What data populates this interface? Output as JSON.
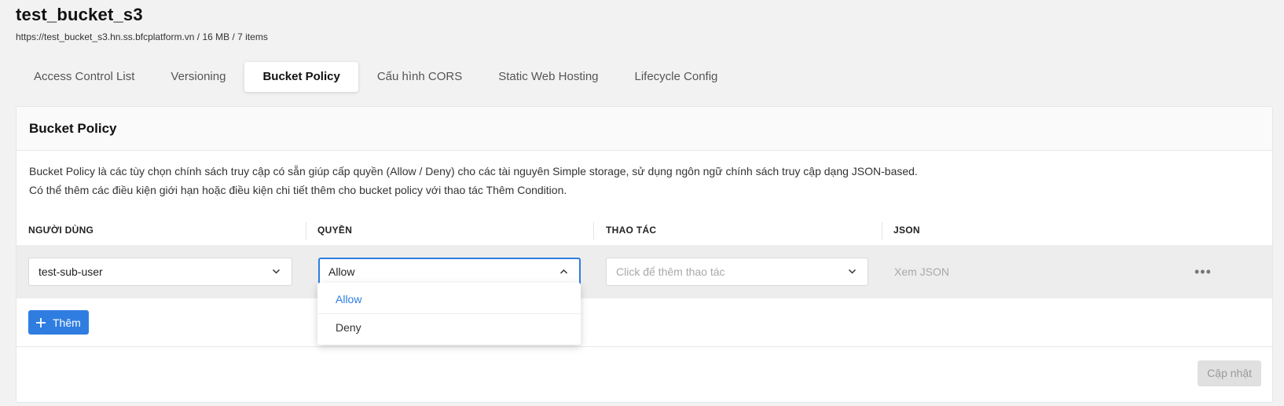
{
  "header": {
    "title": "test_bucket_s3",
    "subtitle": "https://test_bucket_s3.hn.ss.bfcplatform.vn / 16 MB / 7 items"
  },
  "tabs": [
    {
      "label": "Access Control List"
    },
    {
      "label": "Versioning"
    },
    {
      "label": "Bucket Policy",
      "active": true
    },
    {
      "label": "Cấu hình CORS"
    },
    {
      "label": "Static Web Hosting"
    },
    {
      "label": "Lifecycle Config"
    }
  ],
  "panel": {
    "title": "Bucket Policy",
    "description_line1": "Bucket Policy là các tùy chọn chính sách truy cập có sẵn giúp cấp quyền (Allow / Deny) cho các tài nguyên Simple storage, sử dụng ngôn ngữ chính sách truy cập dạng JSON-based.",
    "description_line2": "Có thể thêm các điều kiện giới hạn hoặc điều kiện chi tiết thêm cho bucket policy với thao tác Thêm Condition."
  },
  "columns": {
    "user": "NGƯỜI DÙNG",
    "permission": "QUYỀN",
    "action": "THAO TÁC",
    "json": "JSON"
  },
  "row": {
    "user_value": "test-sub-user",
    "permission_value": "Allow",
    "action_placeholder": "Click để thêm thao tác",
    "json_link": "Xem JSON",
    "more": "•••"
  },
  "dropdown": {
    "options": [
      {
        "label": "Allow",
        "selected": true
      },
      {
        "label": "Deny",
        "selected": false
      }
    ]
  },
  "buttons": {
    "add_label": "Thêm",
    "update_label": "Cập nhật"
  },
  "icons": {
    "chevron_down": "chevron-down-icon",
    "chevron_up": "chevron-up-icon",
    "plus": "plus-icon",
    "more": "more-horizontal-icon"
  },
  "colors": {
    "accent": "#2f7de1",
    "disabled_bg": "#e0e0e0"
  }
}
